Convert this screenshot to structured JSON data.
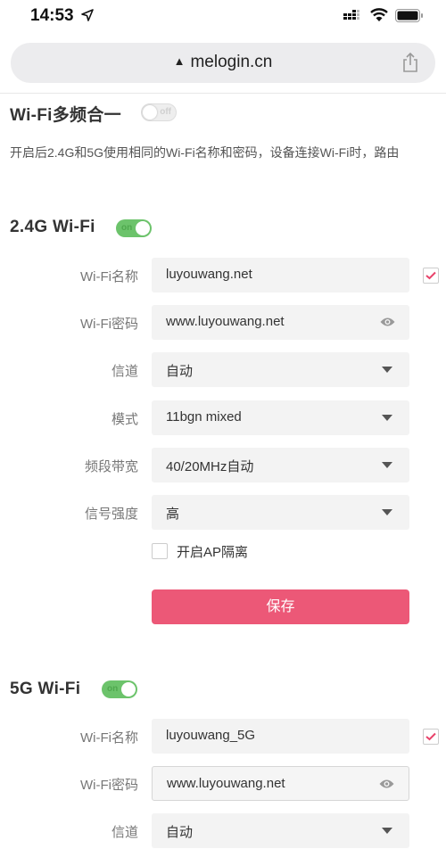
{
  "status_bar": {
    "time": "14:53"
  },
  "browser": {
    "url": "melogin.cn",
    "warning_glyph": "▲"
  },
  "multiband": {
    "title": "Wi-Fi多频合一",
    "toggle_label": "off",
    "enabled": false,
    "description": "开启后2.4G和5G使用相同的Wi-Fi名称和密码，设备连接Wi-Fi时，路由"
  },
  "wifi_24g": {
    "title": "2.4G Wi-Fi",
    "toggle_label": "on",
    "enabled": true,
    "ssid_label": "Wi-Fi名称",
    "ssid_value": "luyouwang.net",
    "ssid_broadcast_checked": true,
    "password_label": "Wi-Fi密码",
    "password_value": "www.luyouwang.net",
    "channel_label": "信道",
    "channel_value": "自动",
    "mode_label": "模式",
    "mode_value": "11bgn mixed",
    "bandwidth_label": "频段带宽",
    "bandwidth_value": "40/20MHz自动",
    "signal_label": "信号强度",
    "signal_value": "高",
    "ap_isolation_label": "开启AP隔离",
    "ap_isolation_checked": false,
    "save_label": "保存"
  },
  "wifi_5g": {
    "title": "5G Wi-Fi",
    "toggle_label": "on",
    "enabled": true,
    "ssid_label": "Wi-Fi名称",
    "ssid_value": "luyouwang_5G",
    "ssid_broadcast_checked": true,
    "password_label": "Wi-Fi密码",
    "password_value": "www.luyouwang.net",
    "channel_label": "信道",
    "channel_value": "自动"
  },
  "colors": {
    "accent": "#ec5877",
    "toggle_on": "#6cc36b",
    "check_mark": "#e8436a"
  }
}
